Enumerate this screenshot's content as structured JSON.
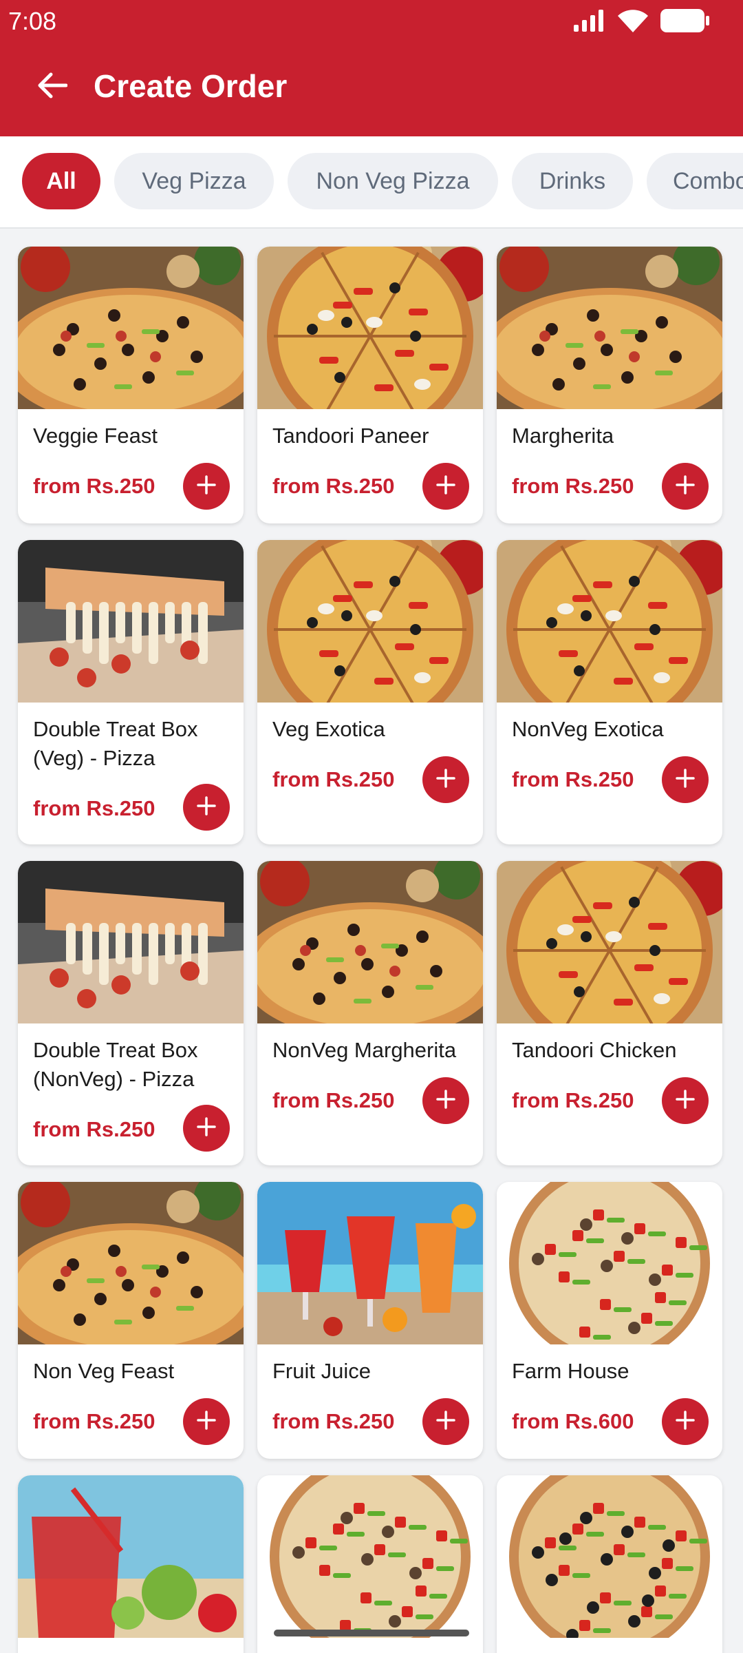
{
  "status_bar": {
    "time": "7:08"
  },
  "header": {
    "title": "Create Order"
  },
  "categories": [
    "All",
    "Veg Pizza",
    "Non Veg Pizza",
    "Drinks",
    "Combo"
  ],
  "items": [
    {
      "name": "Veggie Feast",
      "price": "from Rs.250",
      "image": "pizza-overhead"
    },
    {
      "name": "Tandoori Paneer",
      "price": "from Rs.250",
      "image": "pizza-slices"
    },
    {
      "name": "Margherita",
      "price": "from Rs.250",
      "image": "pizza-overhead"
    },
    {
      "name": "Double Treat Box (Veg) - Pizza",
      "price": "from Rs.250",
      "image": "pizza-cheese-pull"
    },
    {
      "name": "Veg Exotica",
      "price": "from Rs.250",
      "image": "pizza-slices"
    },
    {
      "name": "NonVeg Exotica",
      "price": "from Rs.250",
      "image": "pizza-slices"
    },
    {
      "name": "Double Treat Box (NonVeg) - Pizza",
      "price": "from Rs.250",
      "image": "pizza-cheese-pull"
    },
    {
      "name": "NonVeg Margherita",
      "price": "from Rs.250",
      "image": "pizza-overhead"
    },
    {
      "name": "Tandoori Chicken",
      "price": "from Rs.250",
      "image": "pizza-slices"
    },
    {
      "name": "Non Veg Feast",
      "price": "from Rs.250",
      "image": "pizza-overhead"
    },
    {
      "name": "Fruit Juice",
      "price": "from Rs.250",
      "image": "juice-glasses"
    },
    {
      "name": "Farm House",
      "price": "from Rs.600",
      "image": "pizza-top-view"
    },
    {
      "name": "",
      "price": "",
      "image": "drink-glass"
    },
    {
      "name": "",
      "price": "",
      "image": "pizza-top-view"
    },
    {
      "name": "",
      "price": "",
      "image": "pizza-top-view-dark"
    }
  ],
  "colors": {
    "primary": "#c8202f",
    "chip_bg": "#eef0f4",
    "chip_text": "#5f6a7a",
    "page_bg": "#f2f3f5"
  }
}
